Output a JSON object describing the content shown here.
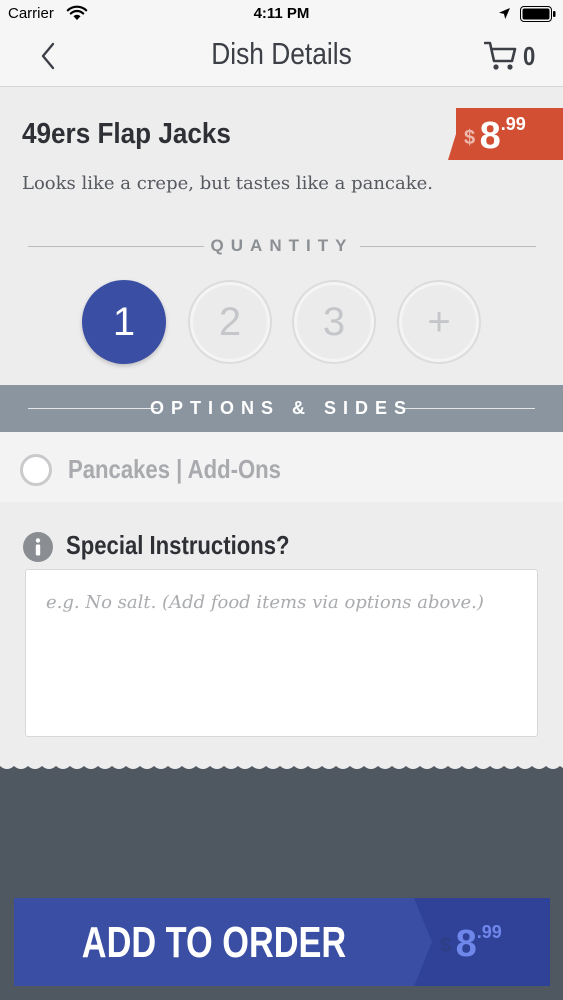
{
  "status_bar": {
    "carrier": "Carrier",
    "time": "4:11 PM",
    "wifi_icon": "wifi-icon",
    "location_icon": "location-arrow-icon",
    "battery_icon": "battery-icon"
  },
  "nav": {
    "title": "Dish Details",
    "back_icon": "chevron-left-icon",
    "cart_icon": "cart-icon",
    "cart_count": "0"
  },
  "dish": {
    "name": "49ers Flap Jacks",
    "description": "Looks like a crepe, but tastes like a pancake.",
    "price": {
      "currency": "$",
      "whole": "8",
      "cents": ".99"
    }
  },
  "quantity": {
    "label": "QUANTITY",
    "options": [
      "1",
      "2",
      "3",
      "+"
    ],
    "selected": "1"
  },
  "options_section": {
    "label": "OPTIONS & SIDES",
    "items": [
      {
        "label": "Pancakes | Add-Ons"
      }
    ]
  },
  "instructions": {
    "label": "Special Instructions?",
    "info_icon": "info-icon",
    "value": "",
    "placeholder": "e.g. No salt. (Add food items via options above.)"
  },
  "add_to_order": {
    "label": "ADD TO ORDER",
    "price": {
      "currency": "$",
      "whole": "8",
      "cents": ".99"
    }
  },
  "colors": {
    "primary": "#3a4ea3",
    "price_tag": "#d24f34",
    "section_bar": "#8a959f",
    "footer": "#4f5760",
    "background": "#ededee"
  }
}
